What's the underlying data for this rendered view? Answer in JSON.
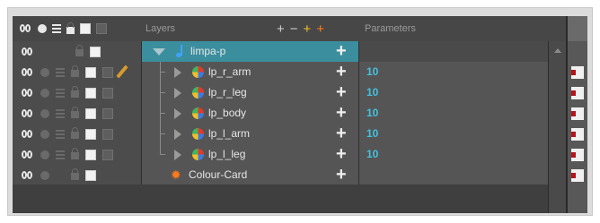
{
  "header": {
    "layers_label": "Layers",
    "parameters_label": "Parameters",
    "tools": [
      "+",
      "−",
      "+",
      "+"
    ]
  },
  "rows": [
    {
      "name": "limpa-p",
      "param": "",
      "selected": true
    },
    {
      "name": "lp_r_arm",
      "param": "10"
    },
    {
      "name": "lp_r_leg",
      "param": "10"
    },
    {
      "name": "lp_body",
      "param": "10"
    },
    {
      "name": "lp_l_arm",
      "param": "10"
    },
    {
      "name": "lp_l_leg",
      "param": "10"
    },
    {
      "name": "Colour-Card",
      "param": ""
    }
  ],
  "icons": {
    "group": "note-icon",
    "peg": "peg-icon",
    "colour_card": "sun-icon",
    "expand": "triangle-icon",
    "add": "plus-icon"
  },
  "colors": {
    "selected_row": "#3b8e9d",
    "param_value": "#44c2e0",
    "keyframe": "#b3141b",
    "pencil": "#d79a2e"
  }
}
